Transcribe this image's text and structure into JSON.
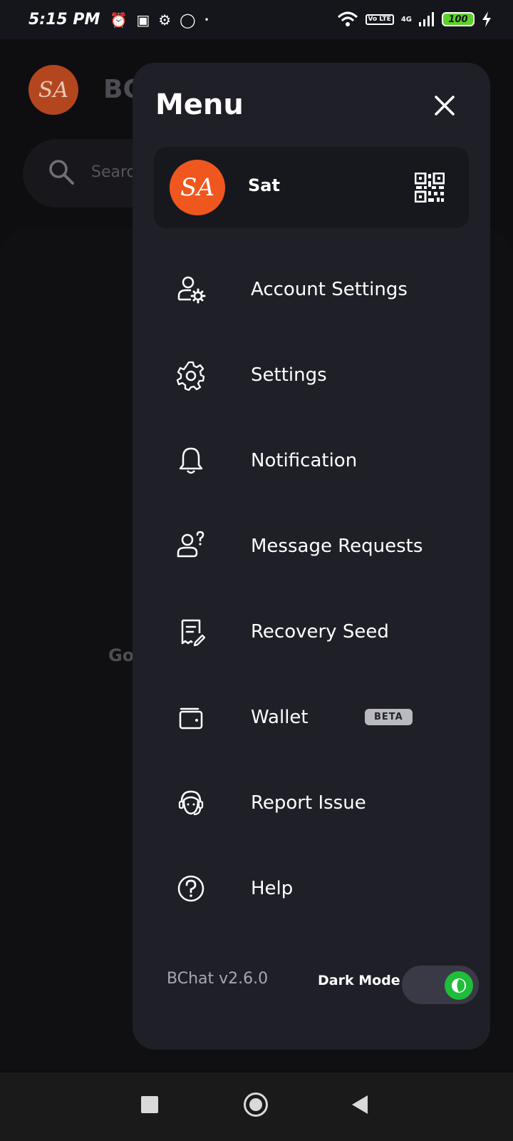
{
  "status_bar": {
    "time": "5:15 PM",
    "battery": "100",
    "network": "4G",
    "volte": "Vo LTE"
  },
  "background_app": {
    "avatar_initials": "SA",
    "title_partial": "BC",
    "search_placeholder_partial": "Searc",
    "partial_text": "Go"
  },
  "menu": {
    "title": "Menu",
    "profile": {
      "initials": "SA",
      "name": "Sat"
    },
    "items": [
      {
        "label": "Account Settings",
        "icon": "account-settings-icon"
      },
      {
        "label": "Settings",
        "icon": "gear-icon"
      },
      {
        "label": "Notification",
        "icon": "bell-icon"
      },
      {
        "label": "Message Requests",
        "icon": "message-request-icon"
      },
      {
        "label": "Recovery Seed",
        "icon": "recovery-seed-icon"
      },
      {
        "label": "Wallet",
        "icon": "wallet-icon",
        "badge": "BETA"
      },
      {
        "label": "Report Issue",
        "icon": "support-agent-icon"
      },
      {
        "label": "Help",
        "icon": "help-icon"
      }
    ],
    "version": "BChat v2.6.0",
    "dark_mode_label": "Dark Mode",
    "dark_mode_on": true
  },
  "colors": {
    "panel": "#1e1f27",
    "avatar": "#f0571f",
    "toggle_on": "#1fbd39"
  }
}
